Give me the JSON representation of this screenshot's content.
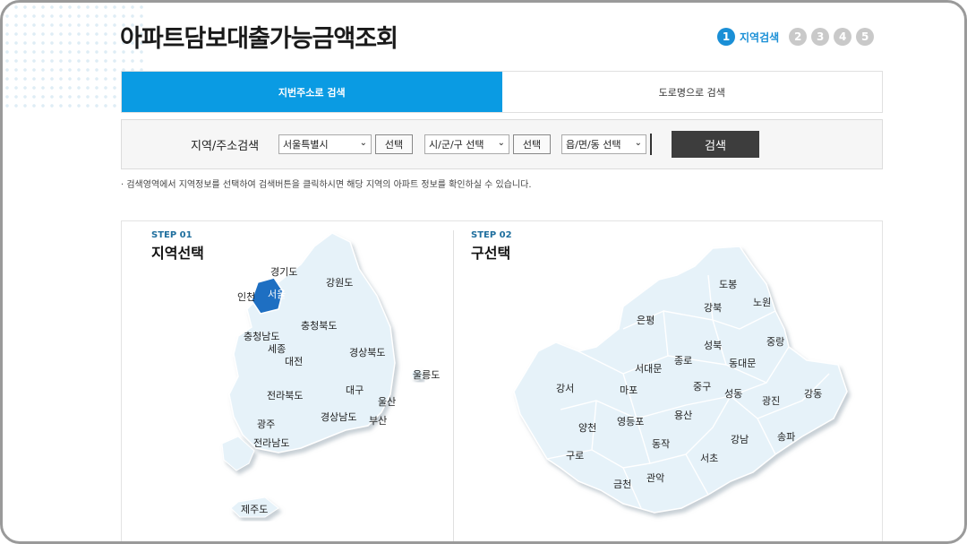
{
  "header": {
    "title": "아파트담보대출가능금액조회",
    "steps": [
      {
        "num": "1",
        "label": "지역검색"
      },
      {
        "num": "2"
      },
      {
        "num": "3"
      },
      {
        "num": "4"
      },
      {
        "num": "5"
      }
    ]
  },
  "tabs": [
    {
      "label": "지번주소로 검색",
      "active": true
    },
    {
      "label": "도로명으로 검색",
      "active": false
    }
  ],
  "search": {
    "label": "지역/주소검색",
    "sido_value": "서울특별시",
    "sigungu_value": "시/군/구 선택",
    "dong_value": "읍/면/동 선택",
    "select_button": "선택",
    "search_button": "검색",
    "caret": "⌄"
  },
  "notice": "· 검색영역에서 지역정보를 선택하여 검색버튼을 클릭하시면 해당 지역의 아파트 정보를 확인하실 수 있습니다.",
  "step1": {
    "tag": "STEP 01",
    "title": "지역선택",
    "regions": [
      "경기도",
      "인천",
      "서울",
      "강원도",
      "충청북도",
      "충청남도",
      "세종",
      "대전",
      "경상북도",
      "울릉도",
      "전라북도",
      "대구",
      "울산",
      "광주",
      "경상남도",
      "부산",
      "전라남도",
      "제주도"
    ]
  },
  "step2": {
    "tag": "STEP 02",
    "title": "구선택",
    "districts": [
      "도봉",
      "노원",
      "강북",
      "은평",
      "성북",
      "중랑",
      "종로",
      "동대문",
      "서대문",
      "강서",
      "마포",
      "중구",
      "성동",
      "광진",
      "강동",
      "용산",
      "양천",
      "영등포",
      "동작",
      "강남",
      "송파",
      "구로",
      "서초",
      "금천",
      "관악"
    ]
  },
  "colors": {
    "accent": "#0a9be3",
    "step_active": "#1a8fd6",
    "map_fill": "#e6f2f9",
    "map_selected": "#1e6fc2",
    "search_button": "#3d3d3d"
  }
}
